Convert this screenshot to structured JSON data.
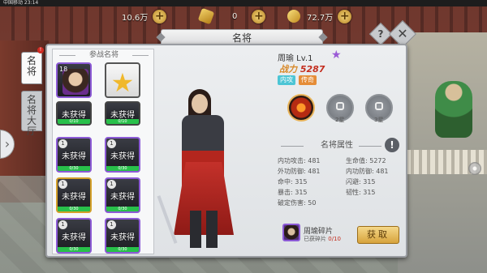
{
  "status": {
    "text": "中国移动 23:14"
  },
  "resources": [
    {
      "name": "silver",
      "icon": "coin-icon",
      "value": "10.6万"
    },
    {
      "name": "gold",
      "icon": "ingot-icon",
      "value": "0"
    },
    {
      "name": "jade",
      "icon": "gem-icon",
      "value": "72.7万"
    }
  ],
  "window": {
    "title": "名将",
    "help_label": "?",
    "close_label": "✕"
  },
  "sidetabs": [
    {
      "label": "名将",
      "active": true
    },
    {
      "label": "名将大厅",
      "active": false
    }
  ],
  "list": {
    "header": "参战名将",
    "slots": [
      {
        "type": "hero",
        "level": "18",
        "name": "",
        "border": "purple"
      },
      {
        "type": "star"
      },
      {
        "type": "locked",
        "level": "",
        "name": "未获得",
        "progress": "0/10",
        "border": "dark"
      },
      {
        "type": "locked",
        "level": "",
        "name": "未获得",
        "progress": "0/10",
        "border": "dark"
      },
      {
        "type": "locked",
        "level": "1",
        "name": "未获得",
        "progress": "0/30",
        "border": "purple"
      },
      {
        "type": "locked",
        "level": "1",
        "name": "未获得",
        "progress": "0/30",
        "border": "purple"
      },
      {
        "type": "locked",
        "level": "1",
        "name": "未获得",
        "progress": "0/30",
        "border": "gold"
      },
      {
        "type": "locked",
        "level": "1",
        "name": "未获得",
        "progress": "0/30",
        "border": "purple"
      },
      {
        "type": "locked",
        "level": "1",
        "name": "未获得",
        "progress": "0/30",
        "border": "purple"
      },
      {
        "type": "locked",
        "level": "1",
        "name": "未获得",
        "progress": "0/30",
        "border": "purple"
      }
    ]
  },
  "hero": {
    "name": "周瑜 Lv.1",
    "power_label": "战力",
    "power_value": "5287",
    "tags": [
      "内攻",
      "传奇"
    ]
  },
  "skills": [
    {
      "caption": "",
      "locked": false
    },
    {
      "caption": "2星",
      "locked": true
    },
    {
      "caption": "3星",
      "locked": true
    }
  ],
  "attributes": {
    "header": "名将属性",
    "info_label": "!",
    "rows": [
      [
        "内功攻击: 481",
        "生命值: 5272"
      ],
      [
        "外功防御: 481",
        "内功防御: 481"
      ],
      [
        "命中: 315",
        "闪避: 315"
      ],
      [
        "暴击: 315",
        "韧性: 315"
      ],
      [
        "破定伤害: 50",
        ""
      ]
    ]
  },
  "fragment": {
    "name": "周瑜碎片",
    "count_label": "已获碎片",
    "count_value": "0/10",
    "button": "获取"
  }
}
